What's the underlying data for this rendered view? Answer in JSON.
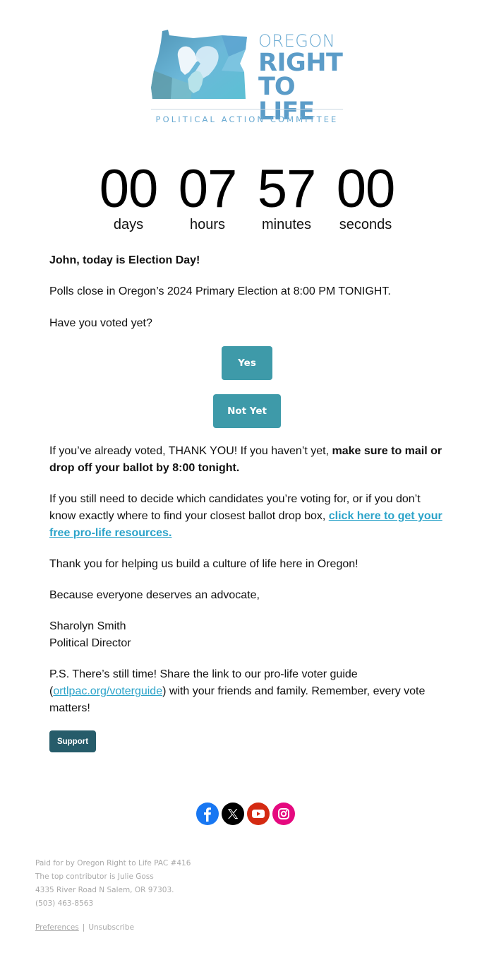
{
  "logo": {
    "line1": "OREGON",
    "line2": "RIGHT",
    "line3": "TO LIFE",
    "tagline": "POLITICAL ACTION COMMITTEE",
    "colors": {
      "primary": "#5b9cc8",
      "map_dark": "#4a8fb0",
      "map_light": "#7fc4e0"
    }
  },
  "countdown": [
    {
      "value": "00",
      "label": "days"
    },
    {
      "value": "07",
      "label": "hours"
    },
    {
      "value": "57",
      "label": "minutes"
    },
    {
      "value": "00",
      "label": "seconds"
    }
  ],
  "body": {
    "greeting": "John, today is Election Day!",
    "polls": "Polls close in Oregon’s 2024 Primary Election at 8:00 PM TONIGHT.",
    "question": "Have you voted yet?",
    "buttons": {
      "yes": "Yes",
      "not_yet": "Not Yet"
    },
    "thanks_plain": "If you’ve already voted, THANK YOU! If you haven’t yet, ",
    "thanks_bold": "make sure to mail or drop off your ballot by 8:00 tonight.",
    "decide_plain": "If you still need to decide which candidates you’re voting for, or if you don’t know exactly where to find your closest ballot drop box, ",
    "decide_link": "click here to get your free pro-life resources.",
    "culture": "Thank you for helping us build a culture of life here in Oregon!",
    "closing": "Because everyone deserves an advocate,",
    "signer_name": "Sharolyn Smith",
    "signer_title": "Political Director",
    "ps_start": "P.S. There’s still time! Share the link to our pro-life voter guide (",
    "ps_link": "ortlpac.org/voterguide",
    "ps_end": ") with your friends and family. Remember, every vote matters!",
    "support_button": "Support"
  },
  "social": [
    {
      "name": "facebook",
      "icon": "facebook-icon",
      "color": "#1877f2"
    },
    {
      "name": "x",
      "icon": "x-icon",
      "color": "#000000"
    },
    {
      "name": "youtube",
      "icon": "youtube-icon",
      "color": "#d42a12"
    },
    {
      "name": "instagram",
      "icon": "instagram-icon",
      "color": "#e5097f"
    }
  ],
  "footer": {
    "lines": [
      "Paid for by Oregon Right to Life PAC #416",
      "The top contributor is Julie Goss",
      "4335 River Road N Salem, OR 97303.",
      "(503) 463-8563"
    ],
    "preferences": "Preferences",
    "separator": "|",
    "unsubscribe": "Unsubscribe"
  },
  "colors": {
    "button_teal": "#3e9aa9",
    "button_dark": "#265c6a",
    "link": "#2ba3c9",
    "footer_text": "#a9a9a9"
  }
}
